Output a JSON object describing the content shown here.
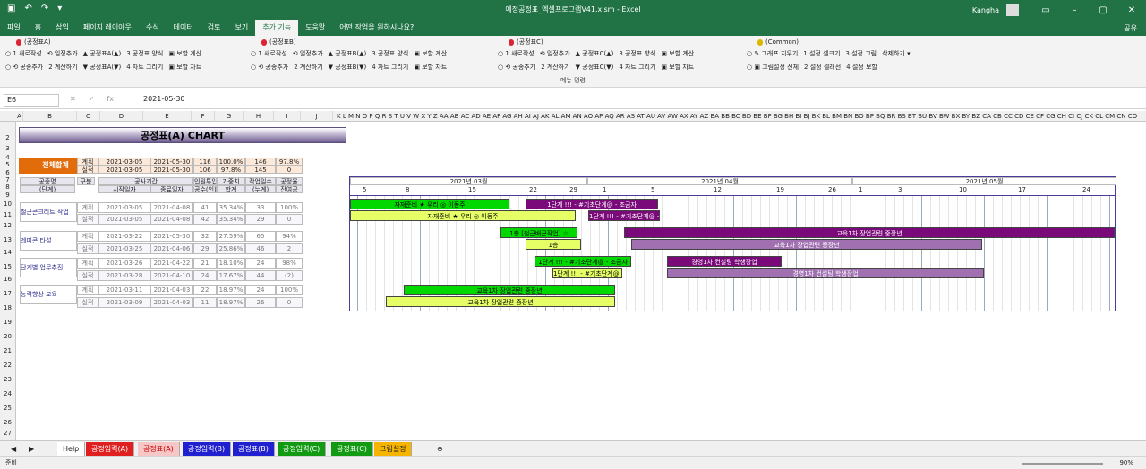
{
  "window": {
    "title": "예정공정표_엑셀프로그램V41.xlsm  -  Excel",
    "user": "Kangha"
  },
  "ribbon_tabs": [
    "파일",
    "홈",
    "삽입",
    "페이지 레이아웃",
    "수식",
    "데이터",
    "검토",
    "보기",
    "추가 기능",
    "도움말",
    "어떤 작업을 원하시나요?"
  ],
  "share_label": "공유",
  "ribbon": {
    "groups": [
      {
        "title": "(공정표A)",
        "row1": [
          "○ 1 새로작성",
          "⟲ 일정추가",
          "▲ 공정표A(▲)",
          "3 공정표 양식",
          "▣ 보할 계산"
        ],
        "row2": [
          "○ ⟲ 공종추가",
          "2 계산하기",
          "▼ 공정표A(▼)",
          "4 차트 그리기",
          "▣ 보할 차트"
        ]
      },
      {
        "title": "(공정표B)",
        "row1": [
          "○ 1 새로작성",
          "⟲ 일정추가",
          "▲ 공정표B(▲)",
          "3 공정표 양식",
          "▣ 보할 계산"
        ],
        "row2": [
          "○ ⟲ 공종추가",
          "2 계산하기",
          "▼ 공정표B(▼)",
          "4 차트 그리기",
          "▣ 보할 차트"
        ]
      },
      {
        "title": "(공정표C)",
        "row1": [
          "○ 1 새로작성",
          "⟲ 일정추가",
          "▲ 공정표C(▲)",
          "3 공정표 양식",
          "▣ 보할 계산"
        ],
        "row2": [
          "○ ⟲ 공종추가",
          "2 계산하기",
          "▼ 공정표C(▼)",
          "4 차트 그리기",
          "▣ 보할 차트"
        ]
      },
      {
        "title": "(Common)",
        "row1": [
          "○ ✎ 그래프 지우기",
          "1 설정 셀크기",
          "3 설정 그림",
          "삭제하기 ▾"
        ],
        "row2": [
          "○ ▣ 그림설정 전체",
          "2 설정 셀래선",
          "4 설정 보할"
        ]
      }
    ],
    "footer": "메뉴 명령"
  },
  "formula_bar": {
    "name_box": "E6",
    "value": "2021-05-30"
  },
  "columns": [
    "A",
    "B",
    "C",
    "D",
    "E",
    "F",
    "G",
    "H",
    "I",
    "J"
  ],
  "rows": [
    "2",
    "3",
    "4",
    "5",
    "6",
    "7",
    "8",
    "9",
    "10",
    "11",
    "12",
    "13",
    "14",
    "15",
    "16",
    "17",
    "18",
    "19",
    "20",
    "21",
    "22",
    "23",
    "24",
    "25",
    "26",
    "27"
  ],
  "chart_title": "공정표(A) CHART",
  "summary": {
    "label": "전체합계",
    "plan": [
      "계획",
      "2021-03-05",
      "2021-05-30",
      "116",
      "100.0%",
      "146",
      "97.8%"
    ],
    "actual": [
      "실적",
      "2021-03-05",
      "2021-05-30",
      "106",
      "97.8%",
      "145",
      "0"
    ],
    "head_start": "전체시작일",
    "head_end": "전체종료일"
  },
  "table_head": {
    "name": "공종명",
    "name_sub": "(단계)",
    "type": "구분",
    "period": "공사기간",
    "start": "시작일자",
    "end": "종료일자",
    "effort": "인원투입",
    "effort_sub": "공수(인)",
    "weight": "가중치",
    "weight_sub": "합계",
    "days": "작업일수",
    "days_sub": "(누계)",
    "rate": "공정율",
    "rate_sub": "잔여공"
  },
  "tasks": [
    {
      "name": "철근콘크리트 작업",
      "plan": [
        "계획",
        "2021-03-05",
        "2021-04-08",
        "41",
        "35.34%",
        "33",
        "100%"
      ],
      "actual": [
        "실적",
        "2021-03-05",
        "2021-04-08",
        "42",
        "35.34%",
        "29",
        "0"
      ]
    },
    {
      "name": "레미콘 타설",
      "plan": [
        "계획",
        "2021-03-22",
        "2021-05-30",
        "32",
        "27.59%",
        "65",
        "94%"
      ],
      "actual": [
        "실적",
        "2021-03-25",
        "2021-04-06",
        "29",
        "25.86%",
        "46",
        "2"
      ]
    },
    {
      "name": "단계별 업무추진",
      "plan": [
        "계획",
        "2021-03-26",
        "2021-04-22",
        "21",
        "18.10%",
        "24",
        "98%"
      ],
      "actual": [
        "실적",
        "2021-03-28",
        "2021-04-10",
        "24",
        "17.67%",
        "44",
        "(2)"
      ]
    },
    {
      "name": "능력향상 교육",
      "plan": [
        "계획",
        "2021-03-11",
        "2021-04-03",
        "22",
        "18.97%",
        "24",
        "100%"
      ],
      "actual": [
        "실적",
        "2021-03-09",
        "2021-04-03",
        "11",
        "18.97%",
        "26",
        "0"
      ]
    }
  ],
  "timeline": {
    "months": [
      "2021년 03월",
      "2021년 04월",
      "2021년 05월"
    ],
    "days": [
      "5",
      "8",
      "15",
      "22",
      "29",
      "1",
      "5",
      "12",
      "19",
      "26",
      "1",
      "3",
      "10",
      "17",
      "24"
    ]
  },
  "bars": [
    {
      "label": "자재준비 ★ 우리 ◎ 이동주",
      "color": "#00d800"
    },
    {
      "label": "1단계 !!! - #기초단계@ - 조금자",
      "color": "#7a0a7a"
    },
    {
      "label": "자재준비 ★ 우리 ◎ 이동주",
      "color": "#e6ff66"
    },
    {
      "label": "1단계 !!! - #기초단계@ -",
      "color": "#7a0a7a"
    },
    {
      "label": "1층 [철근배근작업] ☆",
      "color": "#00d800"
    },
    {
      "label": "교육1차 장업관련 중장년",
      "color": "#7a0a7a"
    },
    {
      "label": "1층",
      "color": "#e6ff66"
    },
    {
      "label": "교육1차 장업관련 중장년",
      "color": "#a070b0"
    },
    {
      "label": "1단계 !!! - #기초단계@ - 조금자",
      "color": "#00d800"
    },
    {
      "label": "경영1차 컨설팅 학생장업",
      "color": "#7a0a7a"
    },
    {
      "label": "1단계 !!! - #기초단계@ -",
      "color": "#e6ff66"
    },
    {
      "label": "경영1차 컨설팅 학생장업",
      "color": "#a070b0"
    },
    {
      "label": "교육1차 장업관련 중장년",
      "color": "#00d800"
    },
    {
      "label": "교육1차 장업관련 중장년",
      "color": "#e6ff66"
    }
  ],
  "sheet_tabs": [
    {
      "label": "Help",
      "color": "#ffffff",
      "text": "#222"
    },
    {
      "label": "공정입력(A)",
      "color": "#e02020",
      "text": "#fff"
    },
    {
      "label": "공정표(A)",
      "color": "#f7c6c6",
      "text": "#c00"
    },
    {
      "label": "공정입력(B)",
      "color": "#2020d0",
      "text": "#fff"
    },
    {
      "label": "공정표(B)",
      "color": "#2020d0",
      "text": "#fff"
    },
    {
      "label": "공정입력(C)",
      "color": "#129a12",
      "text": "#fff"
    },
    {
      "label": "공정표(C)",
      "color": "#129a12",
      "text": "#fff"
    },
    {
      "label": "그림설정",
      "color": "#f5b400",
      "text": "#222"
    }
  ],
  "status": {
    "ready": "준비",
    "zoom": "90%"
  }
}
